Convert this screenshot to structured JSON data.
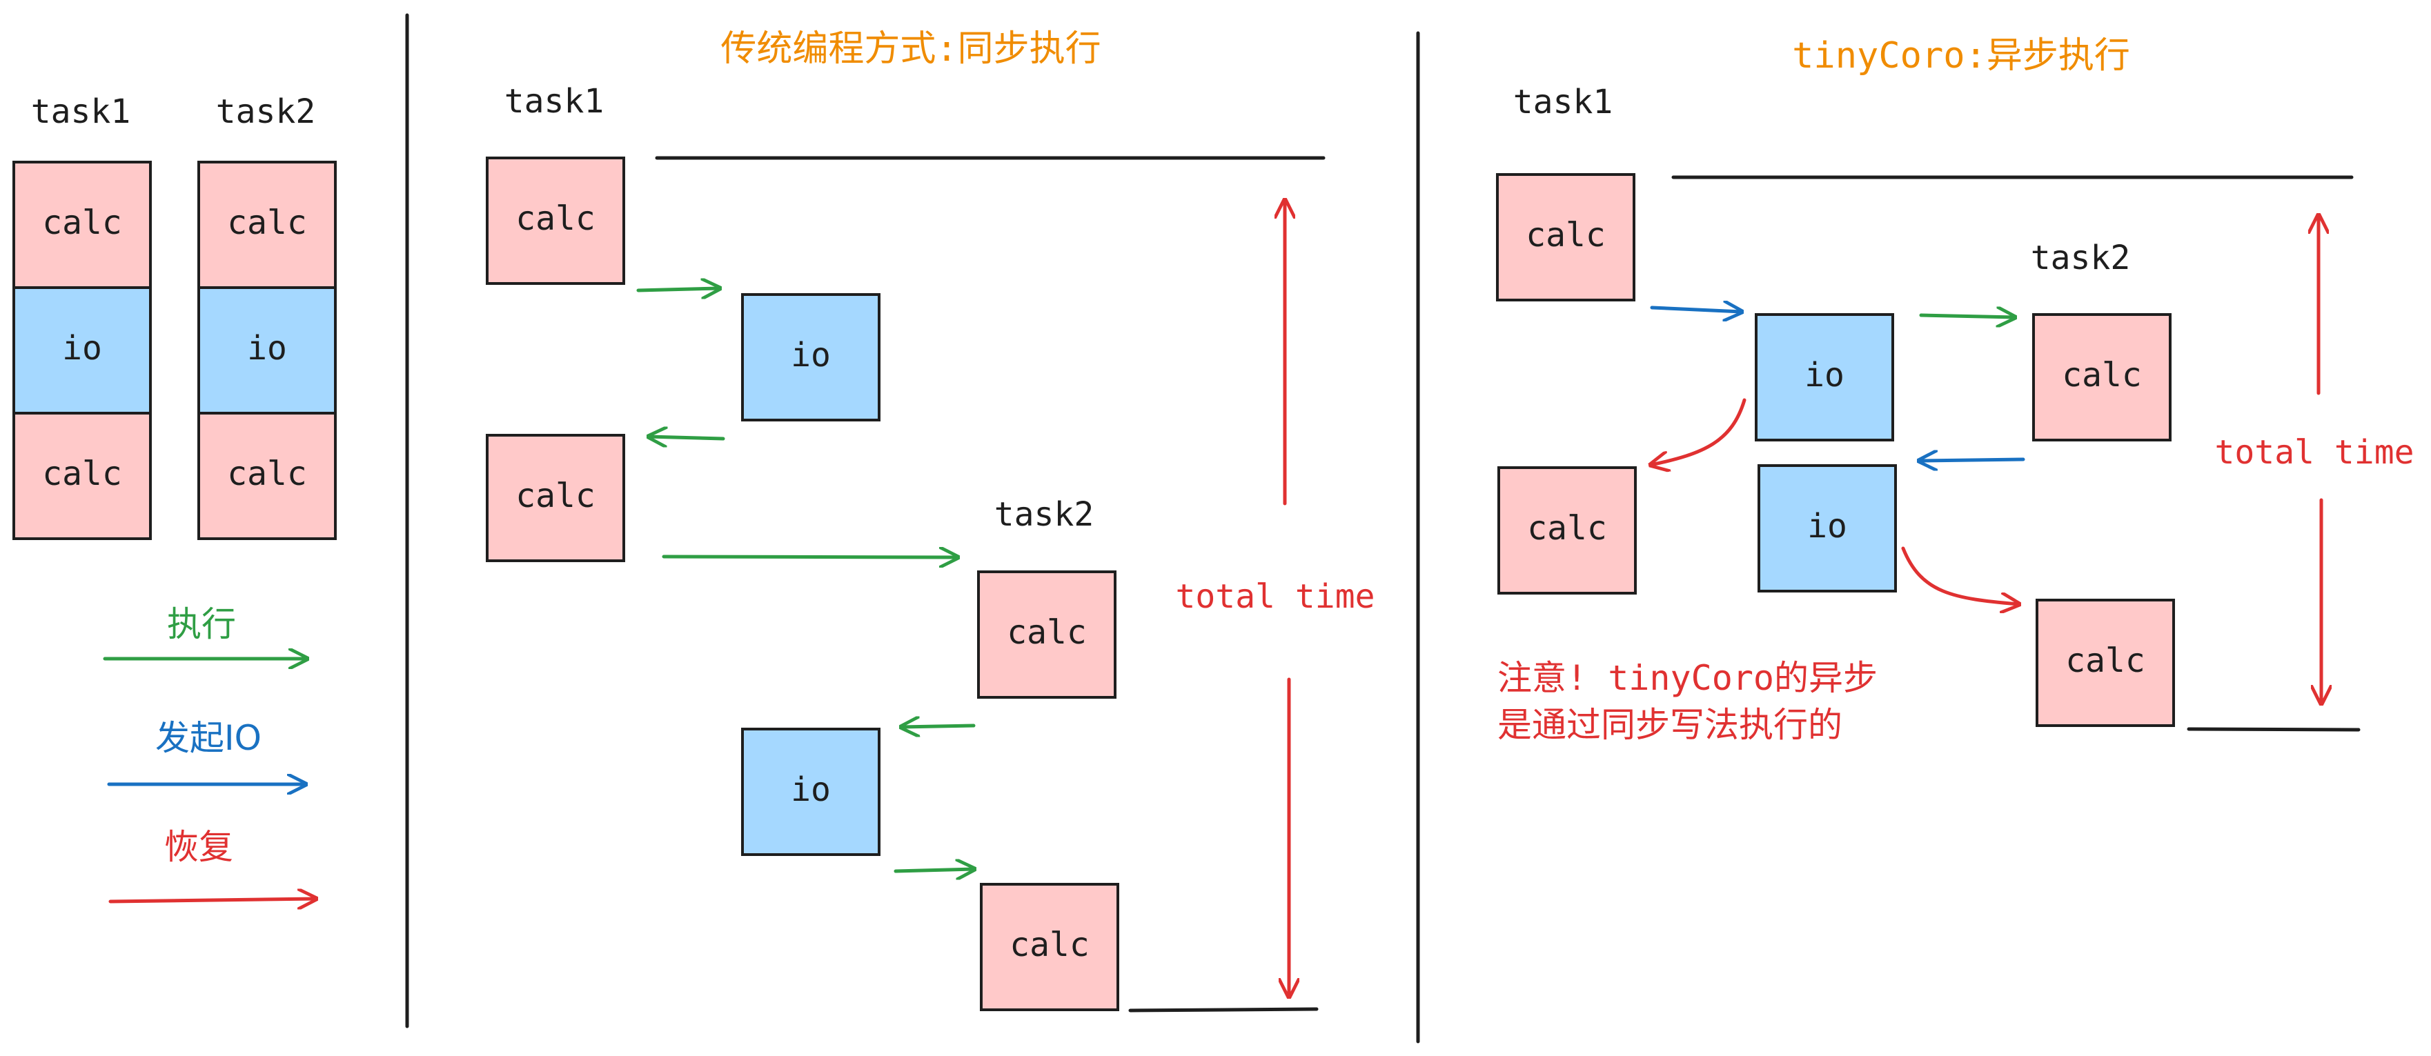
{
  "colors": {
    "calc_fill": "#ffc9c9",
    "io_fill": "#a5d8ff",
    "box_stroke": "#1e1e1e",
    "exec_arrow": "#2f9e44",
    "io_arrow": "#1971c2",
    "resume_arrow": "#e03131",
    "title": "#f08c00"
  },
  "legend": {
    "task1": "task1",
    "task2": "task2",
    "calc": "calc",
    "io": "io",
    "exec": "执行",
    "start_io": "发起IO",
    "resume": "恢复"
  },
  "sync_panel": {
    "title": "传统编程方式:同步执行",
    "task1": "task1",
    "task2": "task2",
    "calc": "calc",
    "io": "io",
    "total_time": "total time"
  },
  "async_panel": {
    "title": "tinyCoro:异步执行",
    "task1": "task1",
    "task2": "task2",
    "calc": "calc",
    "io": "io",
    "total_time": "total time",
    "note_line1": "注意! tinyCoro的异步",
    "note_line2": "是通过同步写法执行的"
  }
}
